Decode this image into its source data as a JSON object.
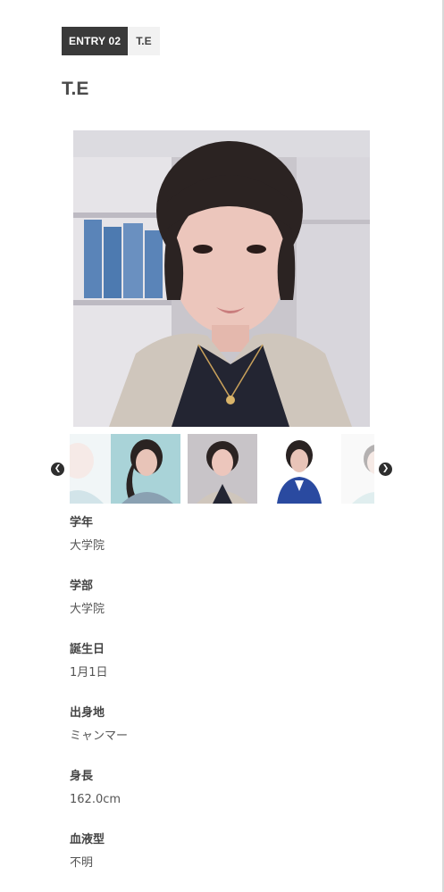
{
  "entry": {
    "number": "ENTRY 02",
    "initials": "T.E"
  },
  "candidate": {
    "name": "T.E"
  },
  "carousel": {
    "prev_icon": "chevron-left-icon",
    "next_icon": "chevron-right-icon"
  },
  "profile": {
    "fields": [
      {
        "label": "学年",
        "value": "大学院"
      },
      {
        "label": "学部",
        "value": "大学院"
      },
      {
        "label": "誕生日",
        "value": "1月1日"
      },
      {
        "label": "出身地",
        "value": "ミャンマー"
      },
      {
        "label": "身長",
        "value": "162.0cm"
      },
      {
        "label": "血液型",
        "value": "不明"
      }
    ]
  },
  "colors": {
    "badge_dark": "#3a3a3a",
    "badge_light": "#f2f2f2",
    "arrow": "#2e2e2e"
  }
}
